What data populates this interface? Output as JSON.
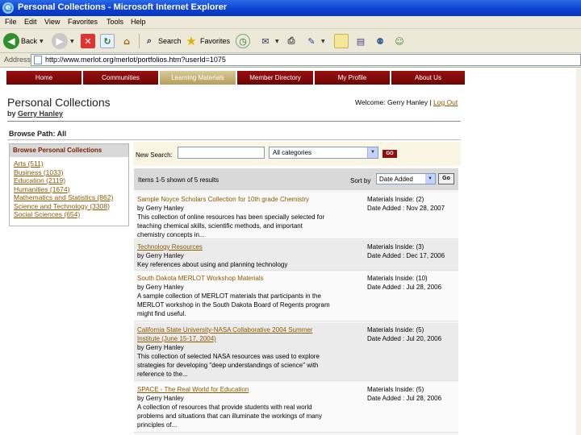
{
  "window": {
    "title": "Personal Collections - Microsoft Internet Explorer"
  },
  "menu": [
    "File",
    "Edit",
    "View",
    "Favorites",
    "Tools",
    "Help"
  ],
  "toolbar": {
    "back_label": "Back",
    "search_label": "Search",
    "favorites_label": "Favorites"
  },
  "address": {
    "label": "Address",
    "url": "http://www.merlot.org/merlot/portfolios.htm?userId=1075"
  },
  "nav_tabs": [
    {
      "label": "Home"
    },
    {
      "label": "Communities"
    },
    {
      "label": "Learning Materials",
      "active": true
    },
    {
      "label": "Member Directory"
    },
    {
      "label": "My Profile"
    },
    {
      "label": "About Us"
    }
  ],
  "page": {
    "title": "Personal Collections",
    "by_prefix": "by",
    "author": "Gerry Hanley",
    "welcome": "Welcome: Gerry Hanley |",
    "logout": "Log Out",
    "browse_path": "Browse Path: All"
  },
  "sidebar": {
    "header": "Browse Personal Collections",
    "items": [
      "Arts (511)",
      "Business (1033)",
      "Education (2119)",
      "Humanities (1674)",
      "Mathematics and Statistics (862)",
      "Science and Technology (3308)",
      "Social Sciences (654)"
    ]
  },
  "search": {
    "label": "New Search:",
    "value": "",
    "category": "All categories",
    "go": "GO"
  },
  "results": {
    "count_text": "Items 1-5 shown of 5 results",
    "sort_label": "Sort by",
    "sort_value": "Date Added",
    "go": "Go",
    "items": [
      {
        "title": "Sample Noyce Scholars Collection for 10th grade Chemistry",
        "by": "by Gerry Hanley",
        "desc": [
          "This collection of online resources has been specially selected for",
          "teaching chemical skills, scientific methods, and important",
          "chemistry concepts in..."
        ],
        "materials": "Materials Inside: (2)",
        "date": "Date Added : Nov 28, 2007"
      },
      {
        "title": "Technology Resources",
        "by": "by Gerry Hanley",
        "desc": [
          "Key references about using and planning technology"
        ],
        "materials": "Materials Inside: (3)",
        "date": "Date Added : Dec 17, 2006"
      },
      {
        "title": "South Dakota MERLOT Workshop Materials",
        "by": "by Gerry Hanley",
        "desc": [
          "A sample collection of MERLOT materials that participants in the",
          "MERLOT workshop in the South Dakota Board of Regents program",
          "might find useful."
        ],
        "materials": "Materials Inside: (10)",
        "date": "Date Added : Jul 28, 2006"
      },
      {
        "title_lines": [
          "California State University-NASA Collaborative 2004 Summer",
          "Institute (June 15-17, 2004)"
        ],
        "by": "by Gerry Hanley",
        "desc": [
          "This collection of selected NASA resources was used to explore",
          "strategies for developing \"deep understandings of science\" with",
          "reference to the..."
        ],
        "materials": "Materials Inside: (5)",
        "date": "Date Added : Jul 20, 2006"
      },
      {
        "title": "SPACE - The Real World for Education",
        "by": "by Gerry Hanley",
        "desc": [
          "A collection of resources that provide students with real world",
          "problems and situations that can illuminate the workings of many",
          "principles of..."
        ],
        "materials": "Materials Inside: (5)",
        "date": "Date Added : Jul 28, 2006"
      }
    ]
  }
}
